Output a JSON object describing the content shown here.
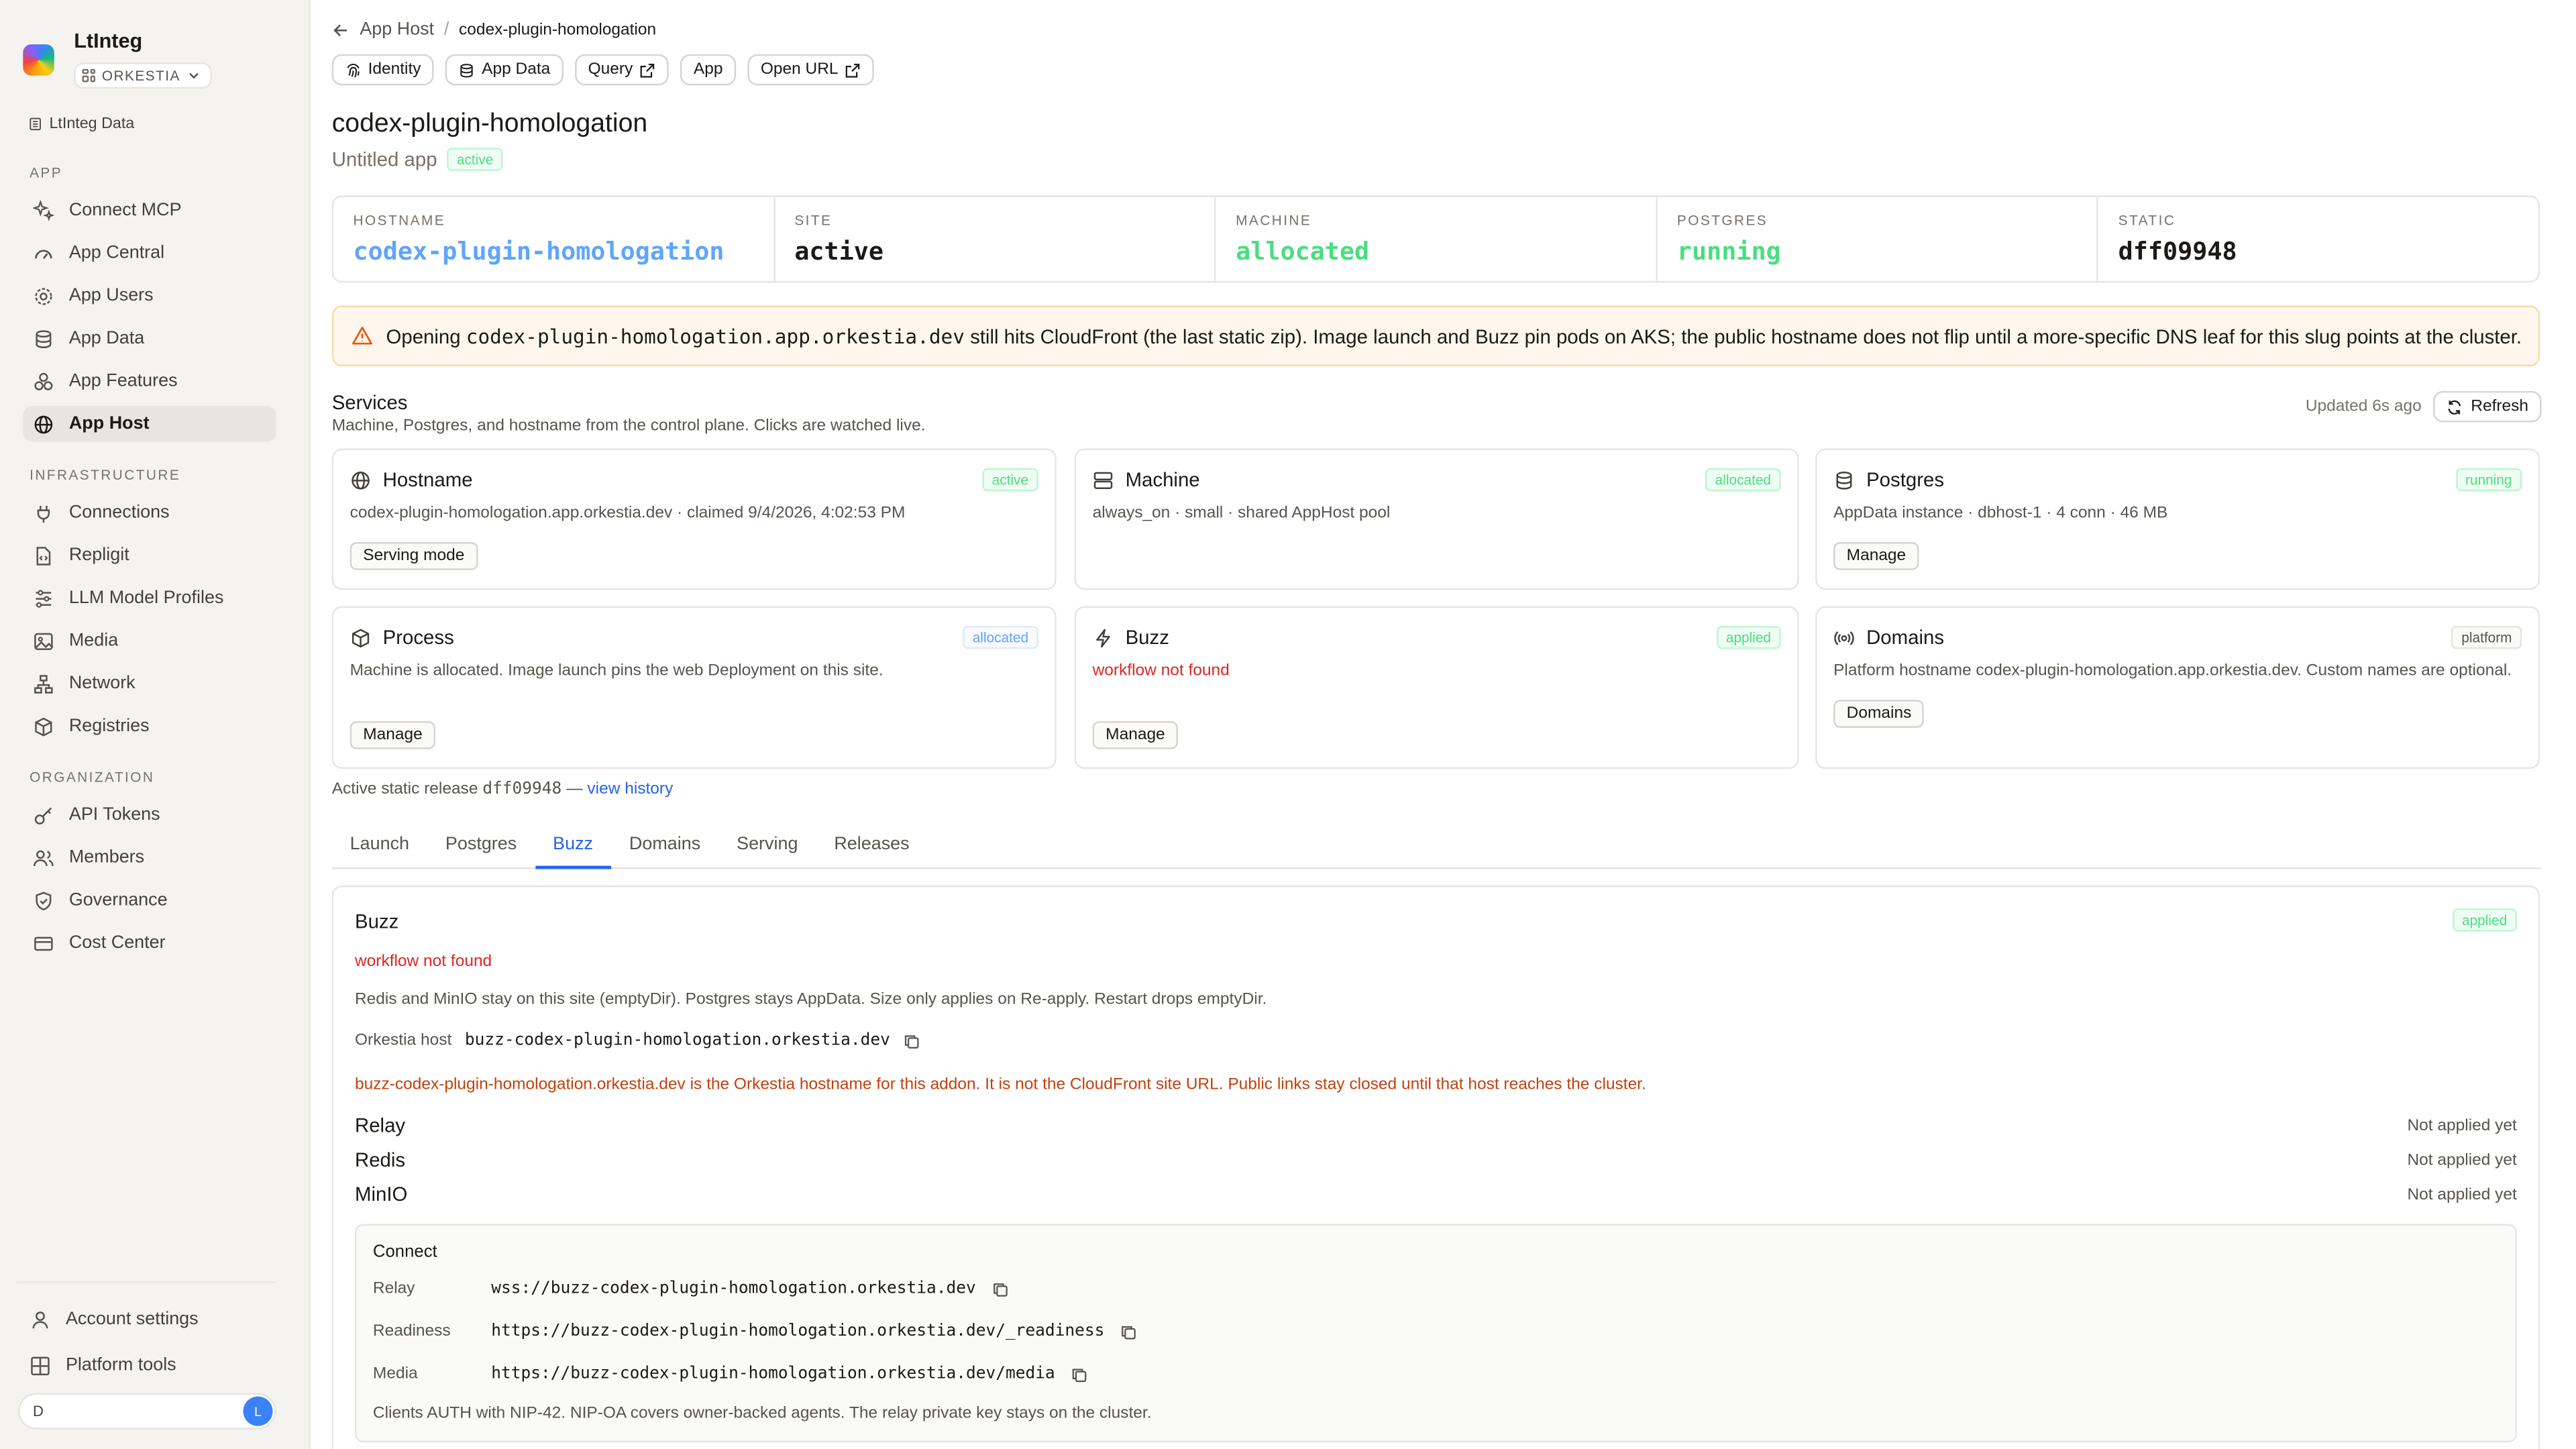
{
  "sidebar": {
    "brand_name": "LtInteg",
    "org": "ORKESTIA",
    "data_link": "LtInteg Data",
    "sections": {
      "app": "APP",
      "infra": "INFRASTRUCTURE",
      "org": "ORGANIZATION"
    },
    "app_items": [
      "Connect MCP",
      "App Central",
      "App Users",
      "App Data",
      "App Features",
      "App Host"
    ],
    "infra_items": [
      "Connections",
      "Repligit",
      "LLM Model Profiles",
      "Media",
      "Network",
      "Registries"
    ],
    "org_items": [
      "API Tokens",
      "Members",
      "Governance",
      "Cost Center"
    ],
    "account_settings": "Account settings",
    "platform_tools": "Platform tools",
    "user_initial": "D",
    "avatar_initial": "L"
  },
  "breadcrumb": {
    "parent": "App Host",
    "separator": "/",
    "current": "codex-plugin-homologation"
  },
  "top_buttons": [
    "Identity",
    "App Data",
    "Query",
    "App",
    "Open URL"
  ],
  "page": {
    "title": "codex-plugin-homologation",
    "subtitle": "Untitled app",
    "status": "active"
  },
  "stats": [
    {
      "label": "HOSTNAME",
      "value": "codex-plugin-homologation",
      "color": "#60a5fa"
    },
    {
      "label": "SITE",
      "value": "active",
      "color": "#1c1917"
    },
    {
      "label": "MACHINE",
      "value": "allocated",
      "color": "#4ade80"
    },
    {
      "label": "POSTGRES",
      "value": "running",
      "color": "#4ade80"
    },
    {
      "label": "STATIC",
      "value": "dff09948",
      "color": "#1c1917"
    }
  ],
  "alert": {
    "prefix": "Opening ",
    "host": "codex-plugin-homologation.app.orkestia.dev",
    "suffix": " still hits CloudFront (the last static zip). Image launch and Buzz pin pods on AKS; the public hostname does not flip until a more-specific DNS leaf for this slug points at the cluster."
  },
  "services": {
    "title": "Services",
    "description": "Machine, Postgres, and hostname from the control plane. Clicks are watched live.",
    "updated": "Updated 6s ago",
    "refresh": "Refresh"
  },
  "cards": {
    "hostname": {
      "title": "Hostname",
      "badge": "active",
      "text": "codex-plugin-homologation.app.orkestia.dev · claimed 9/4/2026, 4:02:53 PM",
      "button": "Serving mode"
    },
    "machine": {
      "title": "Machine",
      "badge": "allocated",
      "text": "always_on · small · shared AppHost pool"
    },
    "postgres": {
      "title": "Postgres",
      "badge": "running",
      "text": "AppData instance · dbhost-1 · 4 conn · 46 MB",
      "button": "Manage"
    },
    "process": {
      "title": "Process",
      "badge": "allocated",
      "text": "Machine is allocated. Image launch pins the web Deployment on this site.",
      "button": "Manage"
    },
    "buzz": {
      "title": "Buzz",
      "badge": "applied",
      "text": "workflow not found",
      "button": "Manage"
    },
    "domains": {
      "title": "Domains",
      "badge": "platform",
      "text": "Platform hostname codex-plugin-homologation.app.orkestia.dev. Custom names are optional.",
      "button": "Domains"
    }
  },
  "release": {
    "prefix": "Active static release ",
    "id": "dff09948",
    "dash": " — ",
    "link": "view history"
  },
  "tabs": [
    "Launch",
    "Postgres",
    "Buzz",
    "Domains",
    "Serving",
    "Releases"
  ],
  "active_tab": "Buzz",
  "buzz_panel": {
    "title": "Buzz",
    "badge": "applied",
    "error": "workflow not found",
    "note": "Redis and MinIO stay on this site (emptyDir). Postgres stays AppData. Size only applies on Re-apply. Restart drops emptyDir.",
    "host_label": "Orkestia host",
    "host_value": "buzz-codex-plugin-homologation.orkestia.dev",
    "warning": "buzz-codex-plugin-homologation.orkestia.dev is the Orkestia hostname for this addon. It is not the CloudFront site URL. Public links stay closed until that host reaches the cluster.",
    "components": [
      {
        "name": "Relay",
        "status": "Not applied yet"
      },
      {
        "name": "Redis",
        "status": "Not applied yet"
      },
      {
        "name": "MinIO",
        "status": "Not applied yet"
      }
    ],
    "connect": {
      "title": "Connect",
      "rows": [
        {
          "key": "Relay",
          "value": "wss://buzz-codex-plugin-homologation.orkestia.dev"
        },
        {
          "key": "Readiness",
          "value": "https://buzz-codex-plugin-homologation.orkestia.dev/_readiness"
        },
        {
          "key": "Media",
          "value": "https://buzz-codex-plugin-homologation.orkestia.dev/media"
        }
      ],
      "footer": "Clients AUTH with NIP-42. NIP-OA covers owner-backed agents. The relay private key stays on the cluster."
    }
  }
}
